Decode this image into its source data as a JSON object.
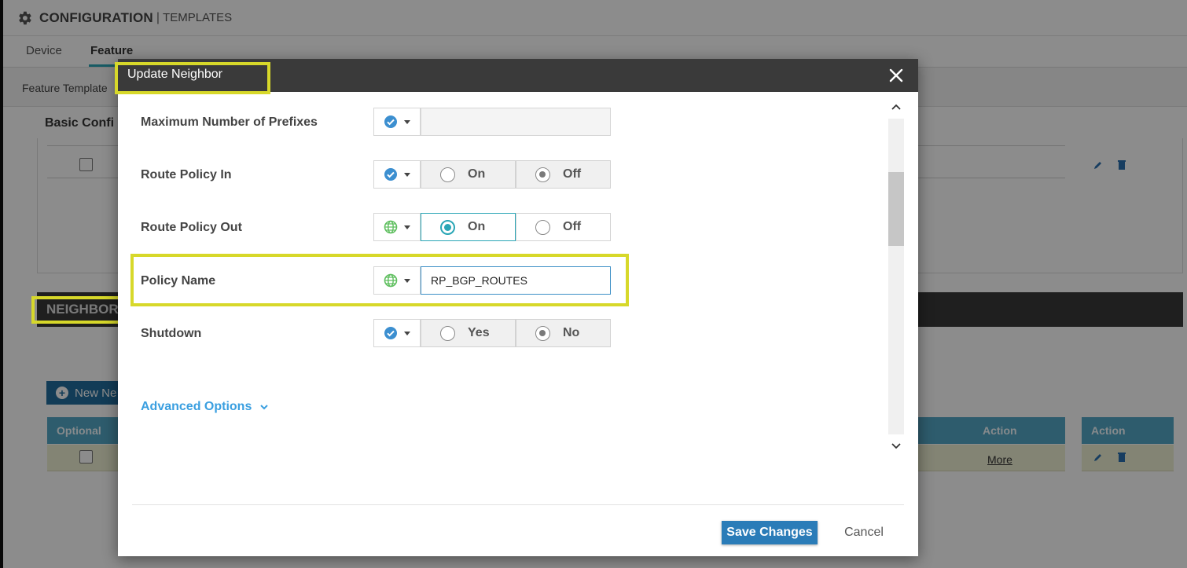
{
  "header": {
    "app_title": "CONFIGURATION",
    "separator": "|",
    "app_subtitle": "TEMPLATES"
  },
  "tabs": [
    {
      "label": "Device",
      "active": false
    },
    {
      "label": "Feature",
      "active": true
    }
  ],
  "breadcrumb": "Feature Template",
  "basic_section_title": "Basic Confi",
  "neighbor_section": {
    "title": "NEIGHBOR",
    "new_button": "New Ne",
    "table_headers": [
      "Optional",
      "Action",
      "Action"
    ],
    "row_link": "More"
  },
  "modal": {
    "title": "Update Neighbor",
    "fields": [
      {
        "label": "Maximum Number of Prefixes",
        "scope": "default",
        "type": "text",
        "value": ""
      },
      {
        "label": "Route Policy In",
        "scope": "default",
        "type": "radio",
        "options": [
          "On",
          "Off"
        ],
        "selected": "Off"
      },
      {
        "label": "Route Policy Out",
        "scope": "global",
        "type": "radio",
        "options": [
          "On",
          "Off"
        ],
        "selected": "On"
      },
      {
        "label": "Policy Name",
        "scope": "global",
        "type": "text",
        "value": "RP_BGP_ROUTES"
      },
      {
        "label": "Shutdown",
        "scope": "default",
        "type": "radio",
        "options": [
          "Yes",
          "No"
        ],
        "selected": "No"
      }
    ],
    "advanced_options": "Advanced Options",
    "save_label": "Save Changes",
    "cancel_label": "Cancel"
  },
  "colors": {
    "accent_teal": "#2aa6b6",
    "primary_blue": "#2a7cb8",
    "link_blue": "#3a9fe0",
    "highlight_yellow": "#d7d82a",
    "header_dark": "#3a3a3a"
  },
  "icons": {
    "scope_default": "check-circle-icon",
    "scope_global": "globe-icon",
    "close": "close-icon",
    "settings": "gear-icon"
  }
}
